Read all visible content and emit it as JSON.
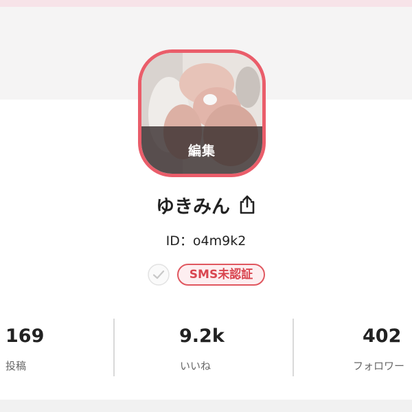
{
  "profile": {
    "avatar_edit_label": "編集",
    "name": "ゆきみん",
    "id_text": "ID：o4m9k2",
    "verification_badge": "SMS未認証"
  },
  "stats": [
    {
      "value": "169",
      "label": "投稿"
    },
    {
      "value": "9.2k",
      "label": "いいね"
    },
    {
      "value": "402",
      "label": "フォロワー"
    }
  ],
  "icons": {
    "share": "share-icon",
    "verification": "check-circle-icon"
  },
  "colors": {
    "accent": "#ea5d6a",
    "badge_text": "#d94650",
    "badge_background": "#fdeef0",
    "header_background": "#f5f4f4",
    "top_band": "#f7e3e8"
  }
}
